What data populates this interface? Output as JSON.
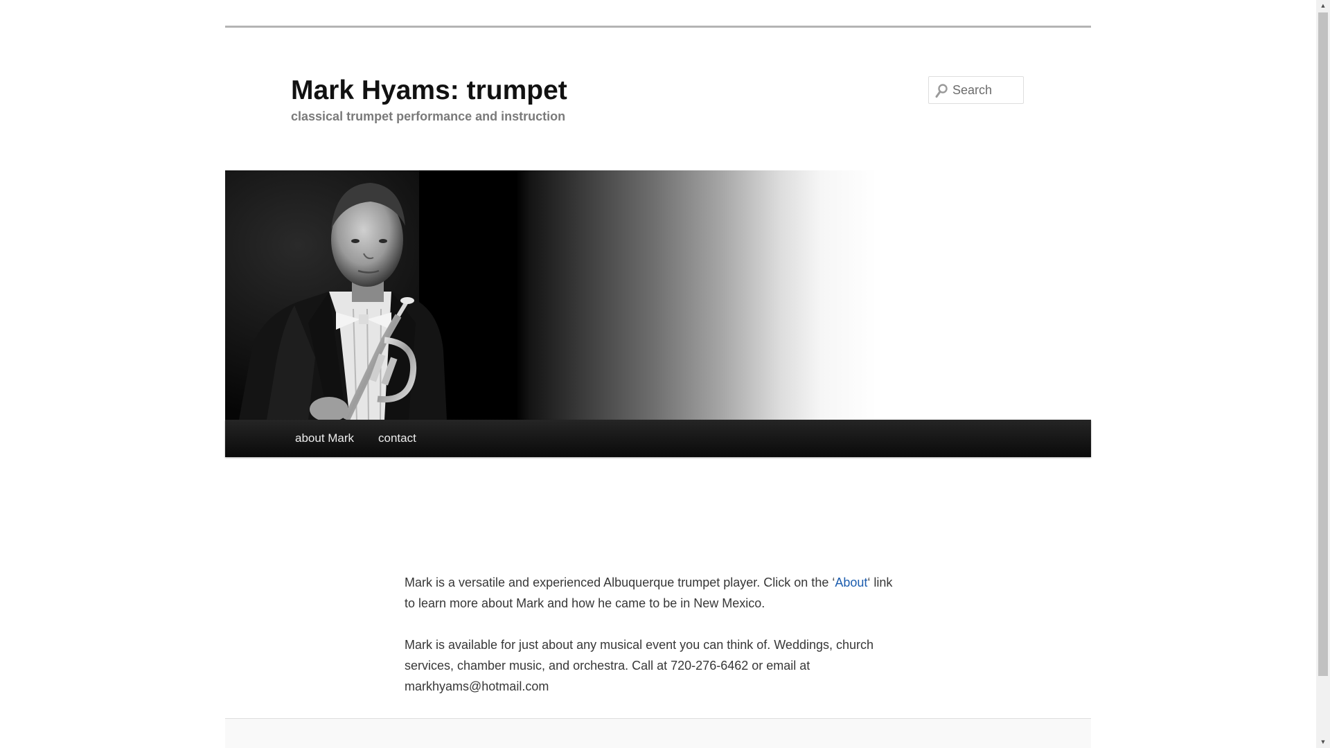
{
  "site": {
    "title": "Mark Hyams: trumpet",
    "tagline": "classical trumpet performance and instruction"
  },
  "search": {
    "placeholder": "Search",
    "icon": "search-icon"
  },
  "header_image": {
    "subject": "trumpet-player-portrait"
  },
  "nav": {
    "items": [
      {
        "label": "about Mark"
      },
      {
        "label": "contact"
      }
    ]
  },
  "content": {
    "p1_text_a": "Mark is a versatile and experienced Albuquerque trumpet player. Click on the ‘",
    "p1_link": "About",
    "p1_text_b": "‘ link to learn more about Mark and how he came to be in New Mexico.",
    "p2_line1": "Mark is available for just about any musical event you can think of. Weddings, church",
    "p2_line2": "services, chamber music, and orchestra. Call at 720-276-6462 or email at",
    "p2_line3": "markhyams@hotmail.com"
  },
  "colors": {
    "link": "#1b5cae",
    "nav_bg": "#111111",
    "title": "#111111"
  }
}
